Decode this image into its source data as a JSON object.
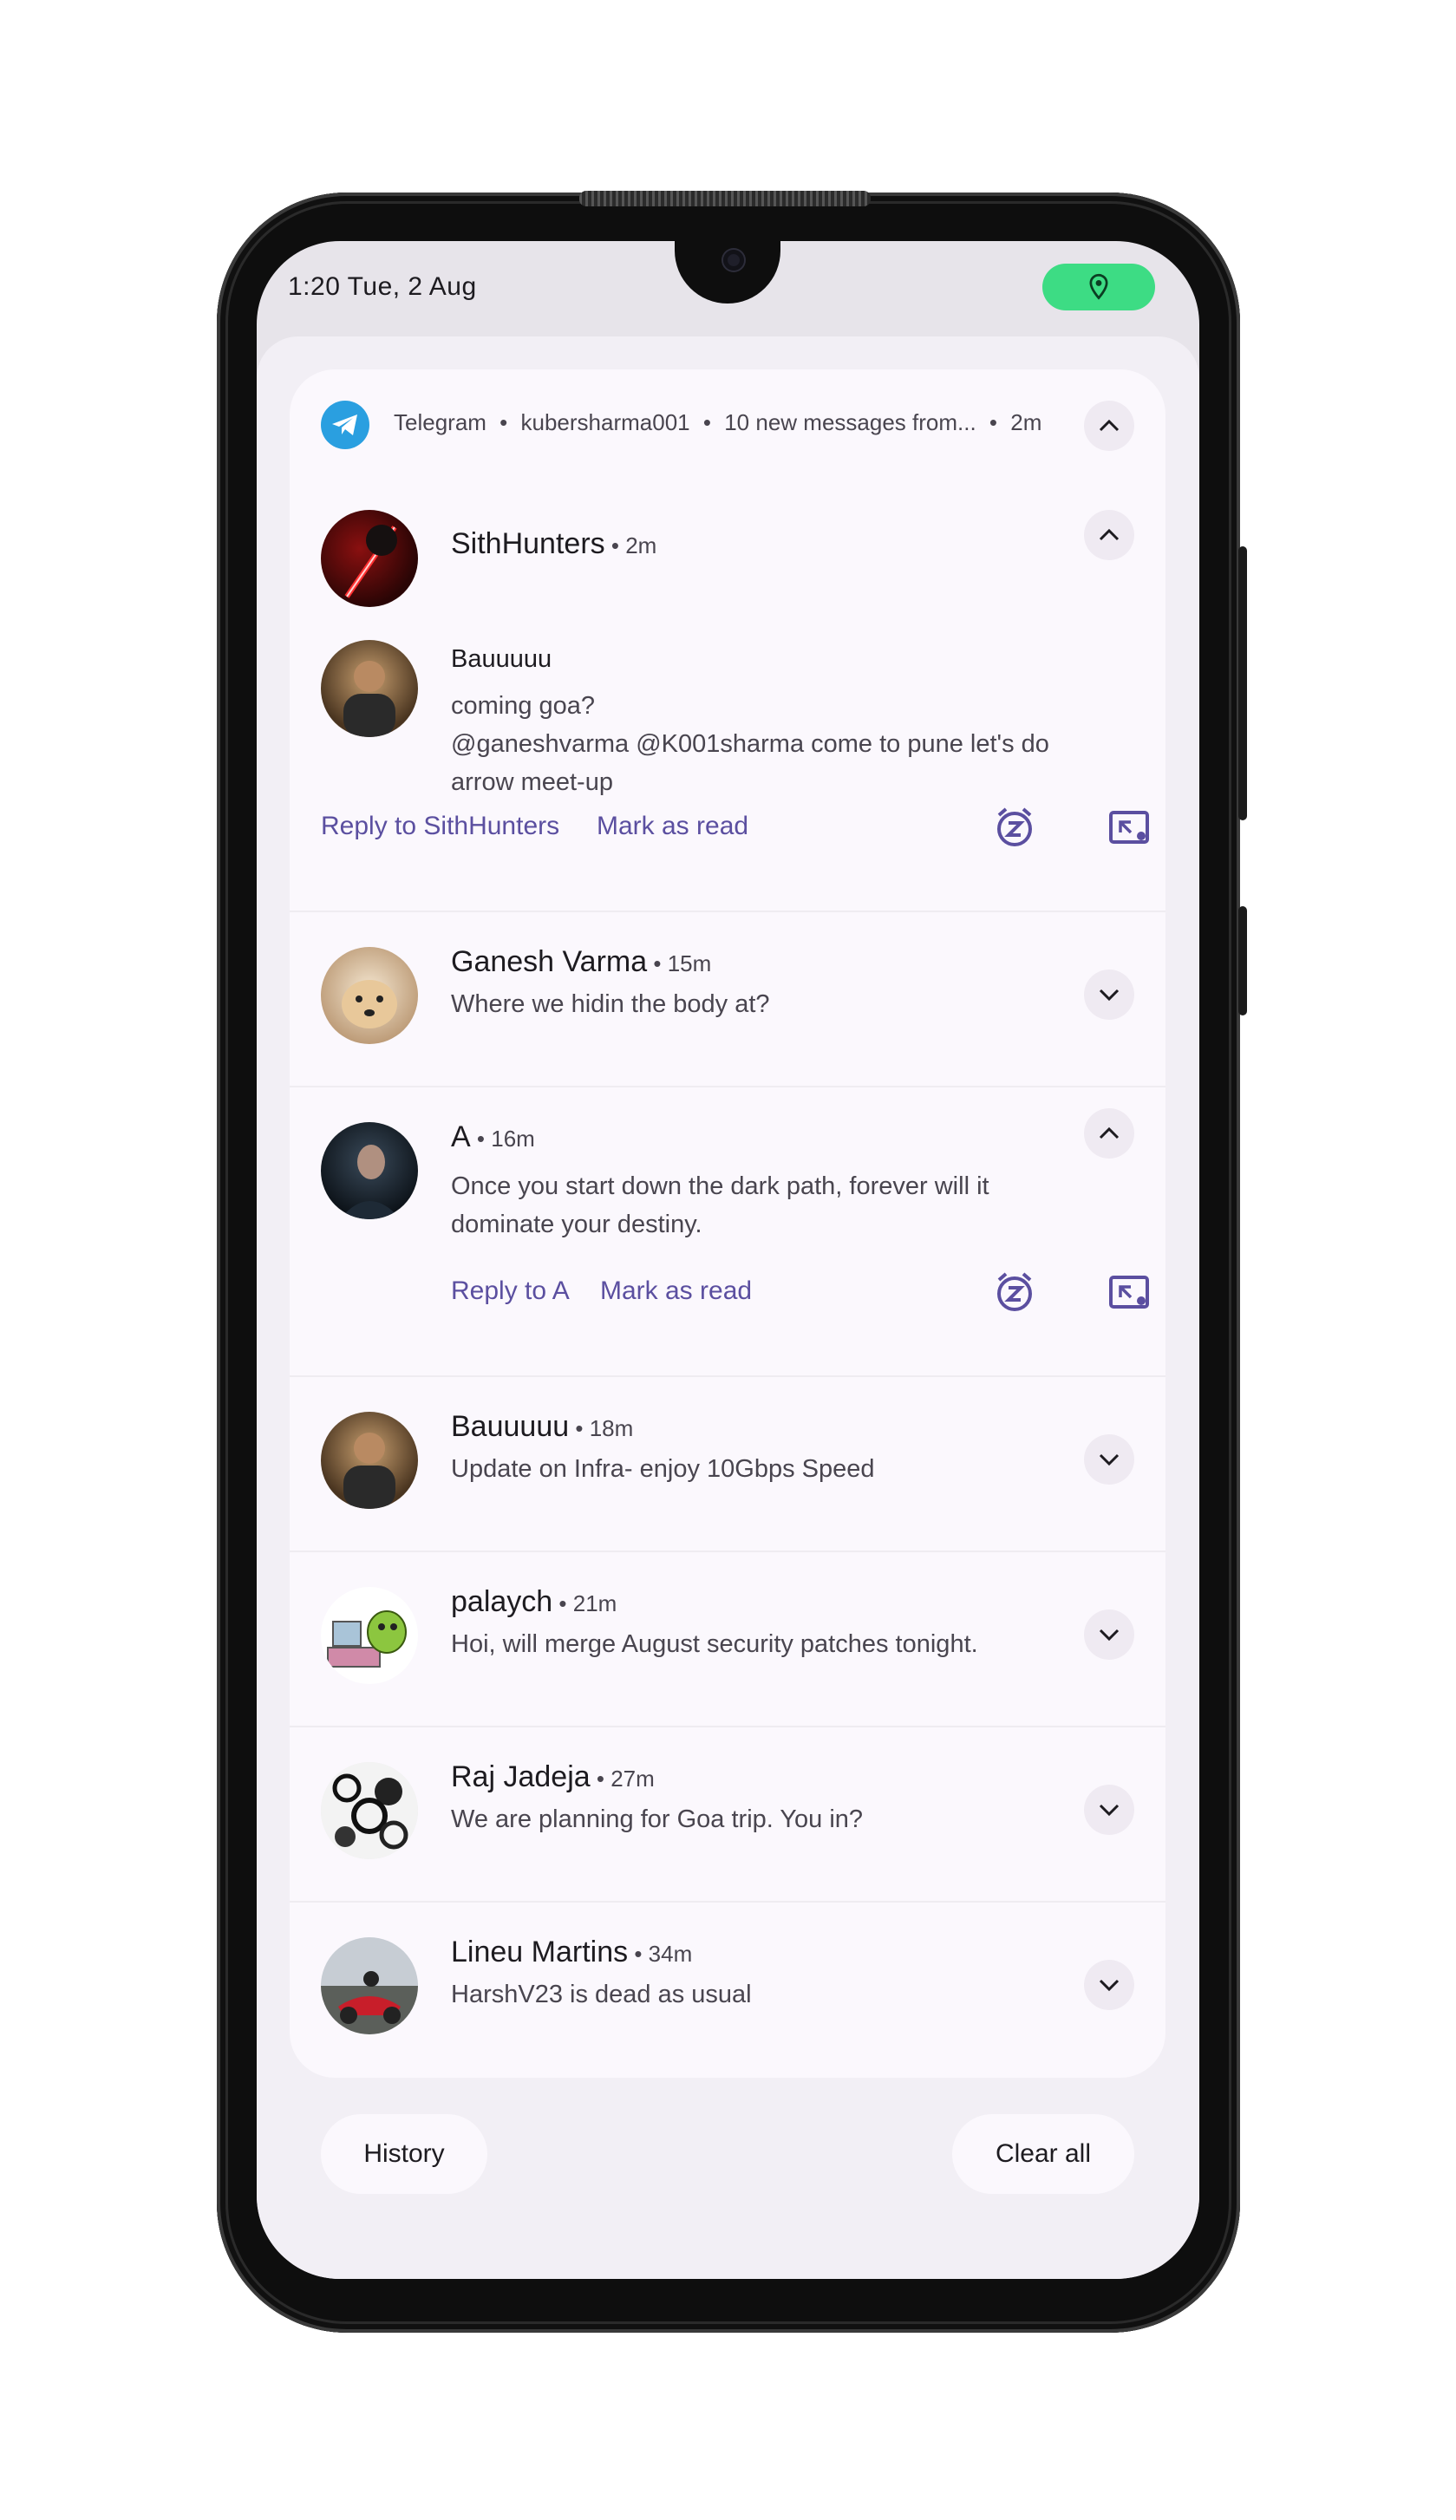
{
  "status_bar": {
    "time": "1:20 Tue, 2 Aug"
  },
  "app_header": {
    "app": "Telegram",
    "account": "kubersharma001",
    "summary": "10 new messages from...",
    "time": "2m",
    "separator": "•"
  },
  "group": {
    "name": "SithHunters",
    "time": "2m",
    "sender": "Bauuuuu",
    "lines": [
      "coming goa?",
      "@ganeshvarma @K001sharma  come to pune let's do",
      "arrow meet-up"
    ],
    "reply": "Reply to SithHunters",
    "mark": "Mark as read"
  },
  "notifications": [
    {
      "name": "Ganesh Varma",
      "time": "15m",
      "text": "Where we hidin the body at?"
    },
    {
      "name": "A",
      "time": "16m",
      "text1": "Once you start down the dark path, forever will it",
      "text2": "dominate your destiny.",
      "reply": "Reply to A",
      "mark": "Mark as read"
    },
    {
      "name": "Bauuuuu",
      "time": "18m",
      "text": "Update on Infra- enjoy 10Gbps Speed"
    },
    {
      "name": "palaych",
      "time": "21m",
      "text": "Hoi, will merge August security patches tonight."
    },
    {
      "name": "Raj Jadeja",
      "time": "27m",
      "text": "We are planning for Goa trip. You in?"
    },
    {
      "name": "Lineu Martins",
      "time": "34m",
      "text": "HarshV23 is dead as usual"
    }
  ],
  "footer": {
    "history": "History",
    "clear_all": "Clear all"
  },
  "colors": {
    "accent": "#5b4fa0",
    "telegram": "#2a9fe0",
    "location_pill": "#3ddc84"
  }
}
